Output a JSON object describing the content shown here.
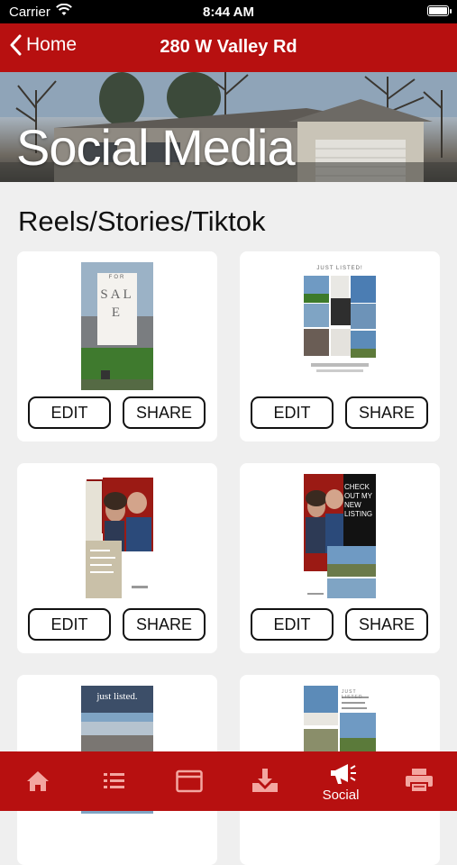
{
  "status": {
    "carrier": "Carrier",
    "time": "8:44 AM"
  },
  "nav": {
    "back_label": "Home",
    "title": "280 W Valley Rd"
  },
  "banner": {
    "title": "Social Media"
  },
  "section": {
    "title": "Reels/Stories/Tiktok"
  },
  "cards": [
    {
      "edit_label": "EDIT",
      "share_label": "SHARE",
      "overlay_text": "SALE",
      "overlay_small": "FOR"
    },
    {
      "edit_label": "EDIT",
      "share_label": "SHARE",
      "overlay_text": "JUST LISTED!"
    },
    {
      "edit_label": "EDIT",
      "share_label": "SHARE"
    },
    {
      "edit_label": "EDIT",
      "share_label": "SHARE",
      "overlay_text": "CHECK OUT MY NEW LISTING"
    },
    {
      "overlay_text": "just listed."
    },
    {
      "overlay_text": "JUST LISTED"
    }
  ],
  "tabs": [
    {
      "icon": "home-icon",
      "label": ""
    },
    {
      "icon": "list-icon",
      "label": ""
    },
    {
      "icon": "browser-icon",
      "label": ""
    },
    {
      "icon": "download-icon",
      "label": ""
    },
    {
      "icon": "megaphone-icon",
      "label": "Social",
      "active": true
    },
    {
      "icon": "printer-icon",
      "label": ""
    }
  ],
  "colors": {
    "brand": "#b71010",
    "background": "#efefef",
    "card": "#ffffff"
  }
}
